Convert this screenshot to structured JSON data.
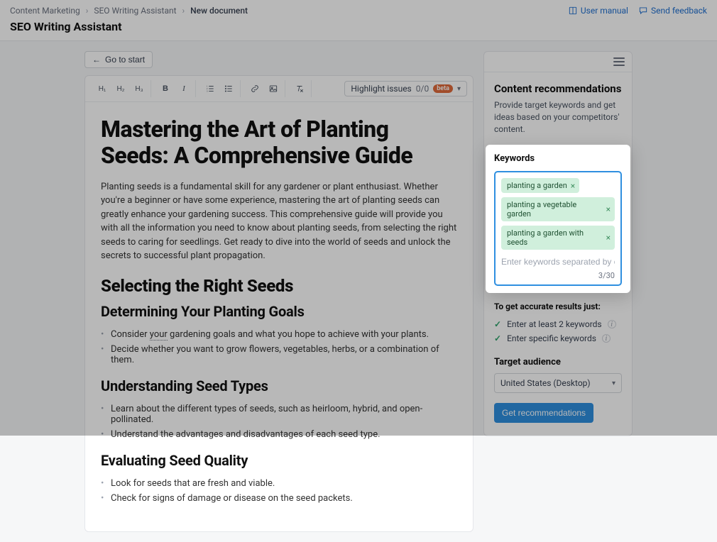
{
  "breadcrumbs": {
    "a": "Content Marketing",
    "b": "SEO Writing Assistant",
    "c": "New document"
  },
  "header": {
    "title": "SEO Writing Assistant",
    "user_manual": "User manual",
    "send_feedback": "Send feedback"
  },
  "go_to_start": "Go to start",
  "toolbar": {
    "h1": "H₁",
    "h2": "H₂",
    "h3": "H₃",
    "highlight_label": "Highlight issues",
    "highlight_count": "0/0",
    "beta": "beta"
  },
  "doc": {
    "title": "Mastering the Art of Planting Seeds: A Comprehensive Guide",
    "intro": "Planting seeds is a fundamental skill for any gardener or plant enthusiast. Whether you're a beginner or have some experience, mastering the art of planting seeds can greatly enhance your gardening success. This comprehensive guide will provide you with all the information you need to know about planting seeds, from selecting the right seeds to caring for seedlings. Get ready to dive into the world of seeds and unlock the secrets to successful plant propagation.",
    "h2a": "Selecting the Right Seeds",
    "h3a": "Determining Your Planting Goals",
    "l1a_pre": "Consider ",
    "l1a_u": "your",
    "l1a_post": " gardening goals and what you hope to achieve with your plants.",
    "l1b": "Decide whether you want to grow flowers, vegetables, herbs, or a combination of them.",
    "h3b": "Understanding Seed Types",
    "l2a": "Learn about the different types of seeds, such as heirloom, hybrid, and open-pollinated.",
    "l2b": "Understand the advantages and disadvantages of each seed type.",
    "h3c": "Evaluating Seed Quality",
    "l3a": "Look for seeds that are fresh and viable.",
    "l3b": "Check for signs of damage or disease on the seed packets."
  },
  "side": {
    "rec_title": "Content recommendations",
    "rec_desc": "Provide target keywords and get ideas based on your competitors' content.",
    "kw_title": "Keywords",
    "kw": {
      "a": "planting a garden",
      "b": "planting a vegetable garden",
      "c": "planting a garden with seeds"
    },
    "kw_placeholder": "Enter keywords separated by commas",
    "kw_count": "3/30",
    "tips_title": "To get accurate results just:",
    "tip1": "Enter at least 2 keywords",
    "tip2": "Enter specific keywords",
    "ta_title": "Target audience",
    "ta_value": "United States (Desktop)",
    "get_rec": "Get recommendations"
  }
}
